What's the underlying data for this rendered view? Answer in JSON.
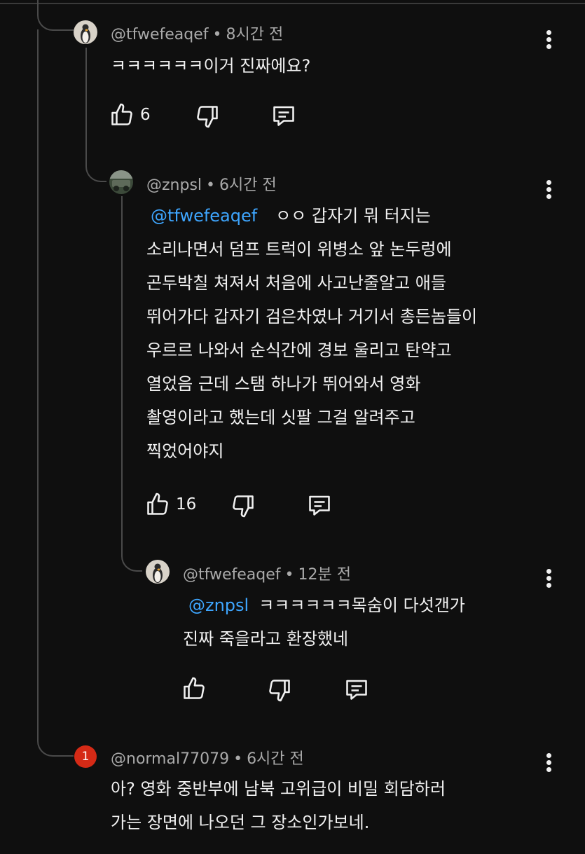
{
  "comments": [
    {
      "author": "@tfwefeaqef",
      "time": "8시간 전",
      "lines": [
        "ㅋㅋㅋㅋㅋㅋ이거 진짜에요?"
      ],
      "likes": "6"
    },
    {
      "author": "@znpsl",
      "time": "6시간 전",
      "mention": "@tfwefeaqef",
      "lines": [
        "ㅇㅇ 갑자기 뭐 터지는",
        "소리나면서 덤프 트럭이 위병소 앞 논두렁에",
        "곤두박칠 쳐져서 처음에 사고난줄알고 애들",
        "뛰어가다 갑자기 검은차였나 거기서 총든놈들이",
        "우르르 나와서 순식간에 경보 울리고 탄약고",
        "열었음 근데 스탬 하나가 뛰어와서 영화",
        "촬영이라고 했는데 싯팔 그걸 알려주고",
        "찍었어야지"
      ],
      "likes": "16"
    },
    {
      "author": "@tfwefeaqef",
      "time": "12분 전",
      "mention": "@znpsl",
      "lines": [
        "ㅋㅋㅋㅋㅋㅋ목숨이 다섯갠가",
        "진짜 죽을라고 환장했네"
      ],
      "likes": ""
    },
    {
      "author": "@normal77079",
      "time": "6시간 전",
      "avatar_letter": "1",
      "lines": [
        "아? 영화 중반부에 남북 고위급이 비밀 회담하러",
        "가는 장면에 나오던 그 장소인가보네."
      ]
    }
  ],
  "colors": {
    "background": "#0f0f0f",
    "text": "#f1f1f1",
    "meta": "#aaaaaa",
    "mention": "#3ea6ff",
    "thread_line": "#4a4a4a",
    "badge": "#d52a16"
  },
  "icons": {
    "like": "thumbs-up-icon",
    "dislike": "thumbs-down-icon",
    "reply": "reply-comment-icon",
    "menu": "more-vert-icon"
  }
}
